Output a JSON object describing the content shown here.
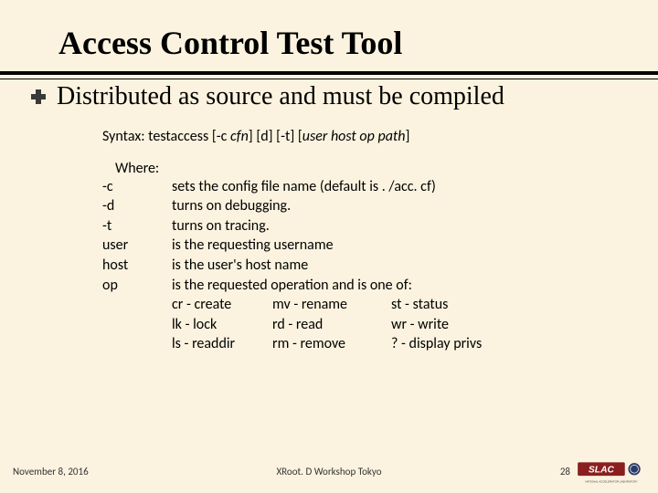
{
  "title": "Access Control Test Tool",
  "bullet": "Distributed as source and must be compiled",
  "syntax": {
    "prefix": "Syntax: testaccess [-c ",
    "cfn": "cfn",
    "mid1": "] [d] [-t] [",
    "args": "user host op path",
    "suffix": "]"
  },
  "where_label": "Where:",
  "options": [
    {
      "flag": "-c",
      "desc": "sets the config file name (default is . /acc. cf)"
    },
    {
      "flag": "-d",
      "desc": "turns on debugging."
    },
    {
      "flag": "-t",
      "desc": "turns on tracing."
    },
    {
      "flag": "user",
      "desc": "is the requesting username"
    },
    {
      "flag": "host",
      "desc": "is the user's host name"
    },
    {
      "flag": "op",
      "desc": "is the requested operation and is one of:"
    }
  ],
  "ops": [
    {
      "c1": "cr - create",
      "c2": "mv - rename",
      "c3": "st  - status"
    },
    {
      "c1": "lk - lock",
      "c2": "rd  - read",
      "c3": "wr - write"
    },
    {
      "c1": "ls - readdir",
      "c2": "rm - remove",
      "c3": "?   - display privs"
    }
  ],
  "footer": {
    "date": "November 8, 2016",
    "center": "XRoot. D Workshop Tokyo",
    "page": "28"
  },
  "logo_alt": "SLAC National Accelerator Laboratory"
}
